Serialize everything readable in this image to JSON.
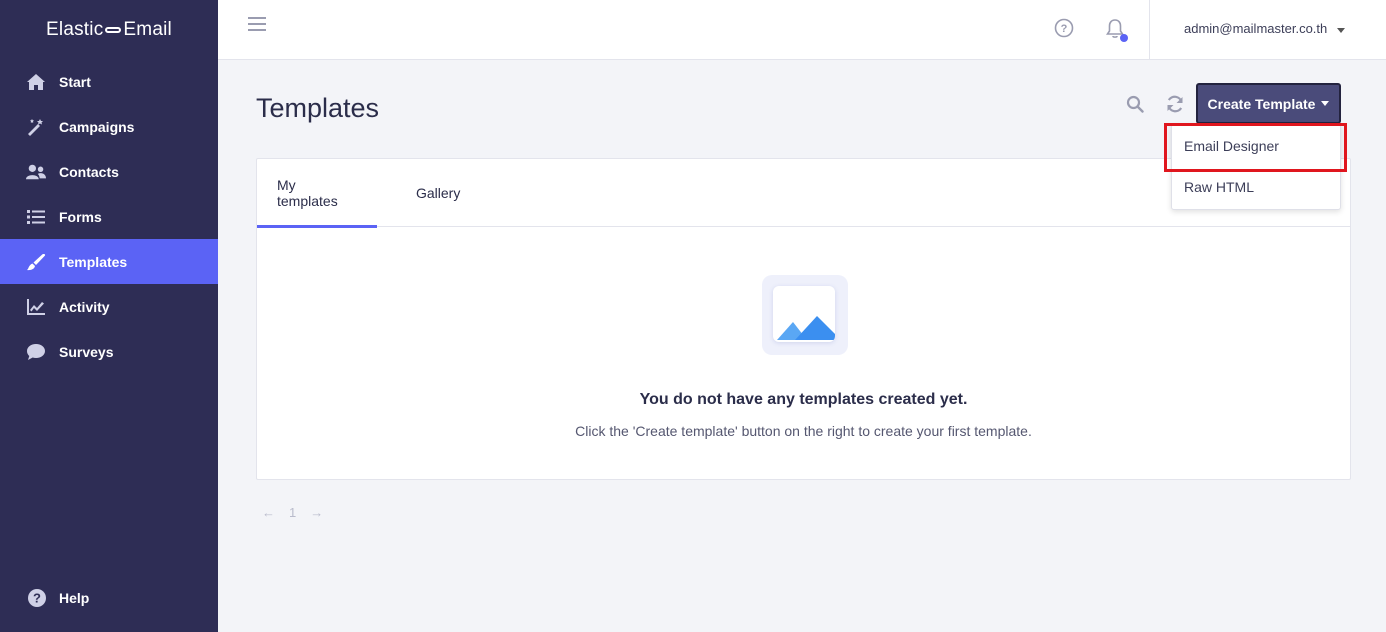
{
  "brand": {
    "left": "Elastic",
    "right": "Email"
  },
  "sidebar": {
    "items": [
      {
        "label": "Start",
        "icon": "home-icon"
      },
      {
        "label": "Campaigns",
        "icon": "magic-wand-icon"
      },
      {
        "label": "Contacts",
        "icon": "users-icon"
      },
      {
        "label": "Forms",
        "icon": "list-icon"
      },
      {
        "label": "Templates",
        "icon": "brush-icon",
        "active": true
      },
      {
        "label": "Activity",
        "icon": "chart-line-icon"
      },
      {
        "label": "Surveys",
        "icon": "chat-bubble-icon"
      }
    ],
    "help_label": "Help"
  },
  "topbar": {
    "account_email": "admin@mailmaster.co.th"
  },
  "main": {
    "title": "Templates",
    "create_button_label": "Create Template",
    "dropdown": {
      "items": [
        "Email Designer",
        "Raw HTML"
      ]
    },
    "tabs": [
      {
        "label": "My templates",
        "active": true
      },
      {
        "label": "Gallery"
      }
    ],
    "empty": {
      "title": "You do not have any templates created yet.",
      "subtitle": "Click the 'Create template' button on the right to create your first template."
    },
    "pager": {
      "page": "1"
    }
  },
  "colors": {
    "sidebar_bg": "#2e2d55",
    "accent": "#5b63f5",
    "create_button_bg": "#4a4b7a",
    "highlight_border": "#e0161e"
  }
}
